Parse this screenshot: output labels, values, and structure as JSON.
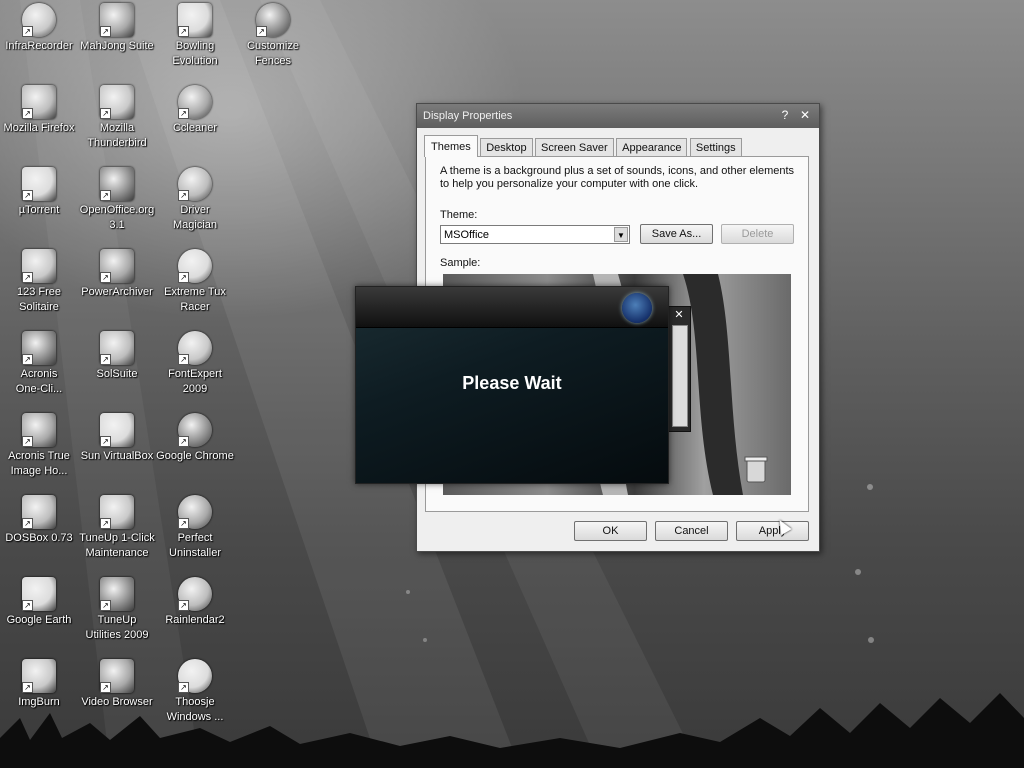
{
  "desktop": {
    "icons": [
      {
        "label": "InfraRecorder",
        "icon": "infrarecorder-icon"
      },
      {
        "label": "MahJong Suite",
        "icon": "mahjong-icon"
      },
      {
        "label": "Bowling\nEvolution",
        "icon": "bowling-icon"
      },
      {
        "label": "Customize\nFences",
        "icon": "fences-icon"
      },
      {
        "label": "Mozilla Firefox",
        "icon": "firefox-icon"
      },
      {
        "label": "Mozilla\nThunderbird",
        "icon": "thunderbird-icon"
      },
      {
        "label": "Ccleaner",
        "icon": "ccleaner-icon"
      },
      {
        "label": "µTorrent",
        "icon": "utorrent-icon"
      },
      {
        "label": "OpenOffice.org\n3.1",
        "icon": "openoffice-icon"
      },
      {
        "label": "Driver\nMagician",
        "icon": "driver-magician-icon"
      },
      {
        "label": "123 Free\nSolitaire",
        "icon": "solitaire-icon"
      },
      {
        "label": "PowerArchiver",
        "icon": "powerarchiver-icon"
      },
      {
        "label": "Extreme Tux\nRacer",
        "icon": "tux-racer-icon"
      },
      {
        "label": "Acronis\nOne-Cli...",
        "icon": "acronis-oneclick-icon"
      },
      {
        "label": "SolSuite",
        "icon": "solsuite-icon"
      },
      {
        "label": "FontExpert\n2009",
        "icon": "fontexpert-icon"
      },
      {
        "label": "Acronis True\nImage Ho...",
        "icon": "acronis-true-image-icon"
      },
      {
        "label": "Sun VirtualBox",
        "icon": "virtualbox-icon"
      },
      {
        "label": "Google Chrome",
        "icon": "chrome-icon"
      },
      {
        "label": "DOSBox 0.73",
        "icon": "dosbox-icon"
      },
      {
        "label": "TuneUp 1-Click\nMaintenance",
        "icon": "tuneup-maintenance-icon"
      },
      {
        "label": "Perfect\nUninstaller",
        "icon": "uninstaller-icon"
      },
      {
        "label": "Google Earth",
        "icon": "google-earth-icon"
      },
      {
        "label": "TuneUp\nUtilities 2009",
        "icon": "tuneup-utilities-icon"
      },
      {
        "label": "Rainlendar2",
        "icon": "rainlendar-icon"
      },
      {
        "label": "ImgBurn",
        "icon": "imgburn-icon"
      },
      {
        "label": "Video Browser",
        "icon": "video-browser-icon"
      },
      {
        "label": "Thoosje\nWindows ...",
        "icon": "thoosje-icon"
      }
    ]
  },
  "dialog": {
    "title": "Display Properties",
    "help_glyph": "?",
    "close_glyph": "✕",
    "tabs": [
      "Themes",
      "Desktop",
      "Screen Saver",
      "Appearance",
      "Settings"
    ],
    "active_tab": "Themes",
    "description": "A theme is a background plus a set of sounds, icons, and other elements to help you personalize your computer with one click.",
    "theme_label": "Theme:",
    "theme_value": "MSOffice",
    "save_as_label": "Save As...",
    "delete_label": "Delete",
    "sample_label": "Sample:",
    "ok_label": "OK",
    "cancel_label": "Cancel",
    "apply_label": "Apply"
  },
  "splash": {
    "message": "Please Wait"
  },
  "mini_window": {
    "close_glyph": "✕"
  }
}
